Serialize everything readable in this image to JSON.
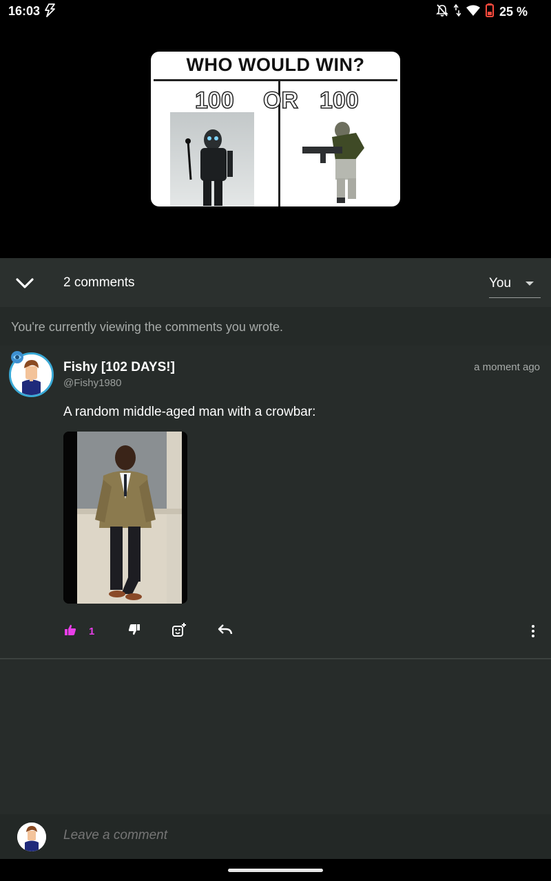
{
  "status_bar": {
    "time": "16:03",
    "battery_text": "25 %"
  },
  "meme": {
    "title": "WHO WOULD WIN?",
    "left_count": "100",
    "or_text": "OR",
    "right_count": "100"
  },
  "comments_header": {
    "count_label": "2 comments",
    "filter_value": "You"
  },
  "info_bar": {
    "text": "You're currently viewing the comments you wrote."
  },
  "comment": {
    "author": "Fishy [102 DAYS!]",
    "handle": "@Fishy1980",
    "timestamp": "a moment ago",
    "text": "A random middle-aged man with a crowbar:",
    "like_count": "1"
  },
  "composer": {
    "placeholder": "Leave a comment"
  },
  "colors": {
    "sheet_bg": "#272c2a",
    "like_accent": "#e83ee8",
    "avatar_ring": "#39a9d6"
  },
  "icons": [
    "bolt-icon",
    "mute-icon",
    "data-arrows-icon",
    "wifi-icon",
    "battery-icon",
    "chevron-down-icon",
    "caret-down-icon",
    "thumbs-up-icon",
    "thumbs-down-icon",
    "emoji-add-icon",
    "reply-icon",
    "more-vert-icon"
  ]
}
